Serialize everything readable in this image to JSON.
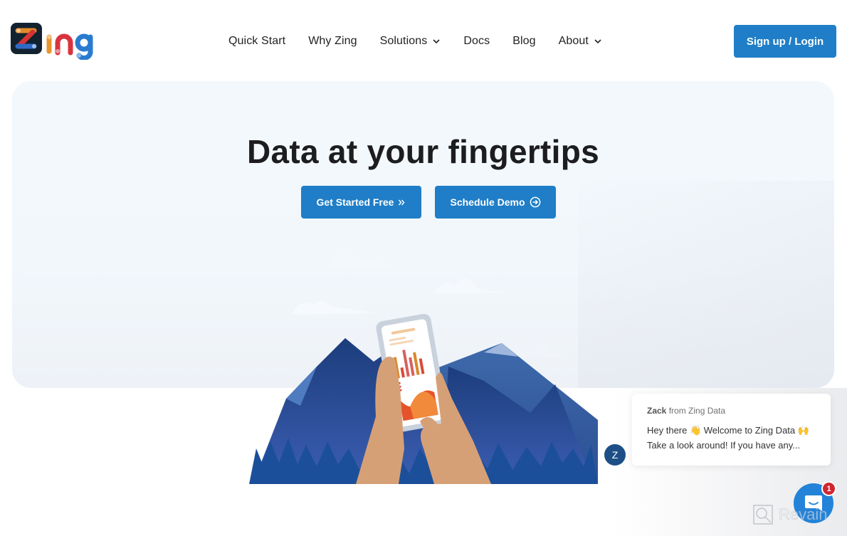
{
  "brand": {
    "name": "Zing",
    "logo_colors": {
      "tile": "#13222f",
      "bar_orange": "#e38a2a",
      "bar_red": "#d63333",
      "bar_blue": "#2f6bc4",
      "i": "#e8952e",
      "n": "#d9333f",
      "g": "#2a7bd0"
    }
  },
  "nav": {
    "items": [
      {
        "label": "Quick Start",
        "has_dropdown": false
      },
      {
        "label": "Why Zing",
        "has_dropdown": false
      },
      {
        "label": "Solutions",
        "has_dropdown": true
      },
      {
        "label": "Docs",
        "has_dropdown": false
      },
      {
        "label": "Blog",
        "has_dropdown": false
      },
      {
        "label": "About",
        "has_dropdown": true
      }
    ],
    "signup_label": "Sign up / Login"
  },
  "hero": {
    "title": "Data at your fingertips",
    "primary_cta": {
      "label": "Get Started Free",
      "icon": "double-chevron-right-icon"
    },
    "secondary_cta": {
      "label": "Schedule Demo",
      "icon": "arrow-circle-right-icon"
    },
    "illustration": "hands-holding-phone-with-charts-mountains"
  },
  "chat": {
    "avatar_initial": "Z",
    "sender_name": "Zack",
    "sender_suffix": "from Zing Data",
    "line1": "Hey there 👋 Welcome to Zing Data 🙌",
    "line2": "Take a look around! If you have any...",
    "unread_count": "1"
  },
  "watermark": {
    "text": "Revain"
  },
  "colors": {
    "accent": "#1f7ec7",
    "title": "#1d1d1f",
    "chat_launcher": "#2283d9",
    "badge": "#d0262e",
    "avatar": "#1d4f86"
  }
}
